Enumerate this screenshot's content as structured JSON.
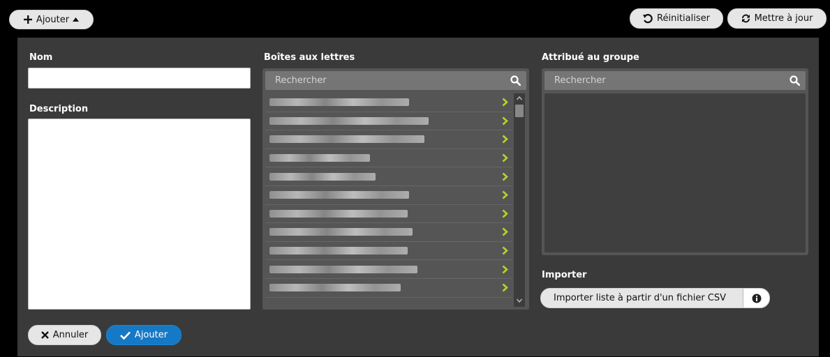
{
  "toolbar": {
    "add_label": "Ajouter",
    "reset_label": "Réinitialiser",
    "update_label": "Mettre à jour"
  },
  "form": {
    "name_label": "Nom",
    "name_value": "",
    "description_label": "Description",
    "description_value": ""
  },
  "mailboxes": {
    "label": "Boîtes aux lettres",
    "search_placeholder": "Rechercher",
    "items": [
      {
        "text_hidden": true
      },
      {
        "text_hidden": true
      },
      {
        "text_hidden": true
      },
      {
        "text_hidden": true
      },
      {
        "text_hidden": true
      },
      {
        "text_hidden": true
      },
      {
        "text_hidden": true
      },
      {
        "text_hidden": true
      },
      {
        "text_hidden": true
      },
      {
        "text_hidden": true
      },
      {
        "text_hidden": true
      }
    ]
  },
  "group": {
    "label": "Attribué au groupe",
    "search_placeholder": "Rechercher"
  },
  "import": {
    "label": "Importer",
    "button_label": "Importer liste à partir d'un fichier CSV"
  },
  "actions": {
    "cancel_label": "Annuler",
    "submit_label": "Ajouter"
  },
  "colors": {
    "background": "#000000",
    "panel": "#3a3a3a",
    "accent": "#1679c5",
    "chevron": "#b5d42a"
  },
  "icons": {
    "add": "plus-icon",
    "caret": "caret-up-icon",
    "reset": "undo-icon",
    "update": "refresh-icon",
    "search": "search-icon",
    "row": "chevron-right-icon",
    "info": "info-icon",
    "cancel": "x-icon",
    "submit": "check-icon"
  }
}
